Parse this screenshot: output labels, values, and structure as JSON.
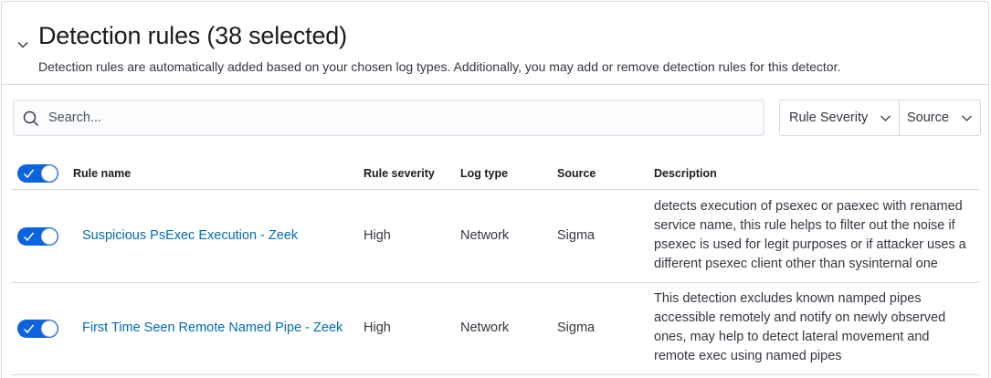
{
  "section": {
    "title": "Detection rules (38 selected)",
    "subtitle": "Detection rules are automatically added based on your chosen log types. Additionally, you may add or remove detection rules for this detector."
  },
  "search": {
    "placeholder": "Search..."
  },
  "filters": {
    "severity_label": "Rule Severity",
    "source_label": "Source"
  },
  "table": {
    "columns": {
      "rule_name": "Rule name",
      "rule_severity": "Rule severity",
      "log_type": "Log type",
      "source": "Source",
      "description": "Description"
    },
    "select_all_enabled": true,
    "rows": [
      {
        "enabled": true,
        "name": "Suspicious PsExec Execution - Zeek",
        "severity": "High",
        "log_type": "Network",
        "source": "Sigma",
        "description": "detects execution of psexec or paexec with renamed service name, this rule helps to filter out the noise if psexec is used for legit purposes or if attacker uses a different psexec client other than sysinternal one"
      },
      {
        "enabled": true,
        "name": "First Time Seen Remote Named Pipe - Zeek",
        "severity": "High",
        "log_type": "Network",
        "source": "Sigma",
        "description": "This detection excludes known namped pipes accessible remotely and notify on newly observed ones, may help to detect lateral movement and remote exec using named pipes"
      }
    ]
  },
  "colors": {
    "accent": "#0b64dd",
    "link": "#006bb8",
    "border": "#d3dae6"
  }
}
